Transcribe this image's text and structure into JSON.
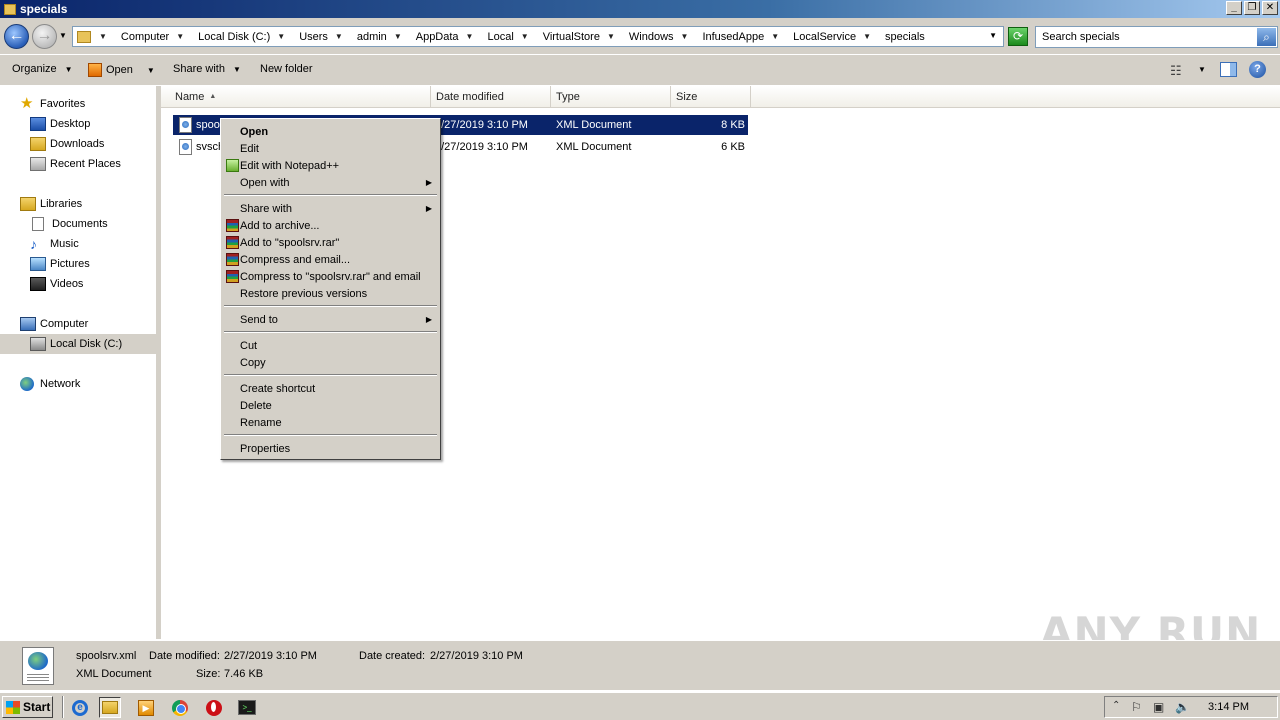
{
  "window": {
    "title": "specials"
  },
  "window_buttons": {
    "minimize": "_",
    "restore": "❐",
    "close": "✕"
  },
  "address": {
    "crumbs": [
      "Computer",
      "Local Disk (C:)",
      "Users",
      "admin",
      "AppData",
      "Local",
      "VirtualStore",
      "Windows",
      "InfusedAppe",
      "LocalService",
      "specials"
    ]
  },
  "search": {
    "placeholder": "Search specials"
  },
  "toolbar": {
    "organize": "Organize",
    "open": "Open",
    "share_with": "Share with",
    "new_folder": "New folder"
  },
  "nav": {
    "favorites": "Favorites",
    "desktop": "Desktop",
    "downloads": "Downloads",
    "recent_places": "Recent Places",
    "libraries": "Libraries",
    "documents": "Documents",
    "music": "Music",
    "pictures": "Pictures",
    "videos": "Videos",
    "computer": "Computer",
    "local_disk": "Local Disk (C:)",
    "network": "Network"
  },
  "columns": {
    "name": "Name",
    "date_modified": "Date modified",
    "type": "Type",
    "size": "Size"
  },
  "files": [
    {
      "name": "spoo",
      "date": "2/27/2019 3:10 PM",
      "type": "XML Document",
      "size": "8 KB",
      "selected": true
    },
    {
      "name": "svsch",
      "date": "2/27/2019 3:10 PM",
      "type": "XML Document",
      "size": "6 KB",
      "selected": false
    }
  ],
  "context_menu": {
    "open": "Open",
    "edit": "Edit",
    "edit_npp": "Edit with Notepad++",
    "open_with": "Open with",
    "share_with": "Share with",
    "add_archive": "Add to archive...",
    "add_rar": "Add to \"spoolsrv.rar\"",
    "compress_email": "Compress and email...",
    "compress_rar_email": "Compress to \"spoolsrv.rar\" and email",
    "restore": "Restore previous versions",
    "send_to": "Send to",
    "cut": "Cut",
    "copy": "Copy",
    "create_shortcut": "Create shortcut",
    "delete": "Delete",
    "rename": "Rename",
    "properties": "Properties"
  },
  "details": {
    "filename": "spoolsrv.xml",
    "date_modified_label": "Date modified:",
    "date_modified": "2/27/2019 3:10 PM",
    "date_created_label": "Date created:",
    "date_created": "2/27/2019 3:10 PM",
    "type": "XML Document",
    "size_label": "Size:",
    "size": "7.46 KB"
  },
  "watermark": "ANY RUN",
  "taskbar": {
    "start": "Start",
    "clock": "3:14 PM"
  }
}
